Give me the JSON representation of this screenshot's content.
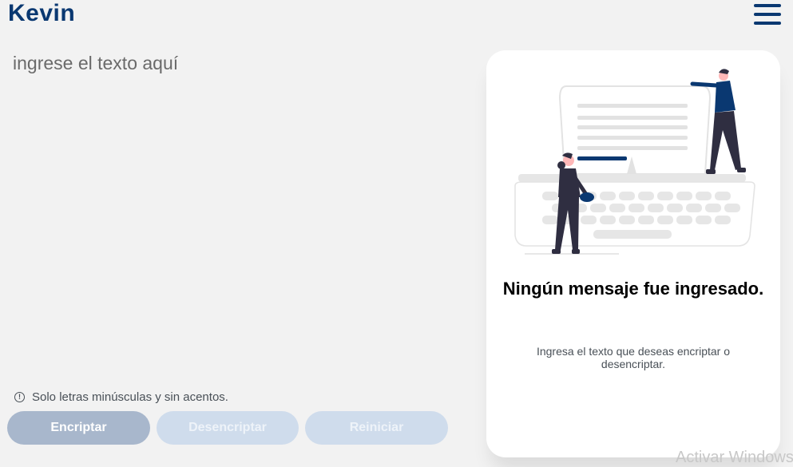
{
  "header": {
    "logo_text": "Kevin",
    "menu_icon": "hamburger-menu-icon"
  },
  "input": {
    "placeholder": "ingrese el texto aquí",
    "value": ""
  },
  "hint": {
    "icon": "info-icon",
    "icon_glyph": "!",
    "text": "Solo letras minúsculas y sin acentos."
  },
  "buttons": {
    "encrypt": "Encriptar",
    "decrypt": "Desencriptar",
    "reset": "Reiniciar"
  },
  "output": {
    "title": "Ningún mensaje fue ingresado.",
    "description": "Ingresa el texto que deseas encriptar o desencriptar."
  },
  "watermark": "Activar Windows",
  "colors": {
    "primary": "#0a3871",
    "background": "#f2f2f2",
    "card": "#ffffff"
  }
}
